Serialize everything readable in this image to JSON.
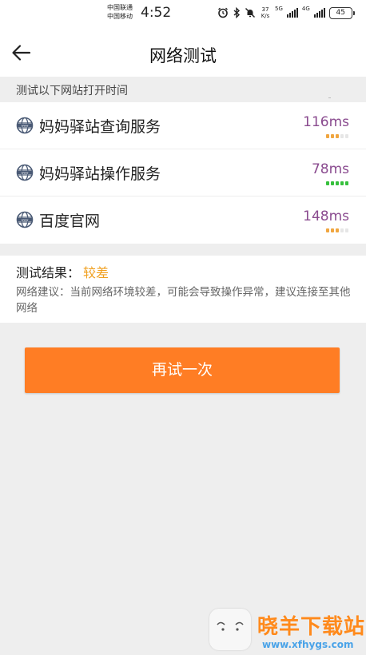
{
  "status_bar": {
    "carrier_1": "中国联通",
    "carrier_2": "中国移动",
    "time": "4:52",
    "speed_value": "37",
    "speed_unit": "K/s",
    "network_1": "5G",
    "network_2": "4G",
    "battery": "45",
    "icons": [
      "alarm-icon",
      "bluetooth-icon",
      "mute-icon",
      "signal-icon",
      "battery-icon"
    ]
  },
  "header": {
    "title": "网络测试",
    "back_icon": "back-arrow-icon"
  },
  "section": {
    "heading": "测试以下网站打开时间"
  },
  "sites": [
    {
      "name": "妈妈驿站查询服务",
      "latency": "116ms",
      "bar_color": "#f0a640",
      "bars_filled": 3,
      "bars_total": 5
    },
    {
      "name": "妈妈驿站操作服务",
      "latency": "78ms",
      "bar_color": "#36c03c",
      "bars_filled": 5,
      "bars_total": 5
    },
    {
      "name": "百度官网",
      "latency": "148ms",
      "bar_color": "#f0a640",
      "bars_filled": 3,
      "bars_total": 5
    }
  ],
  "result": {
    "label": "测试结果：",
    "value": "较差",
    "advice": "网络建议：当前网络环境较差，可能会导致操作异常，建议连接至其他网络"
  },
  "retry_button": "再试一次",
  "watermark": {
    "title": "晓羊下载站",
    "url": "www.xfhygs.com"
  },
  "colors": {
    "accent": "#ff7d24",
    "latency_text": "#8a4b8f",
    "result_value": "#f0a020",
    "watermark_title": "#ff8a1c",
    "watermark_url": "#4aa3e8"
  }
}
